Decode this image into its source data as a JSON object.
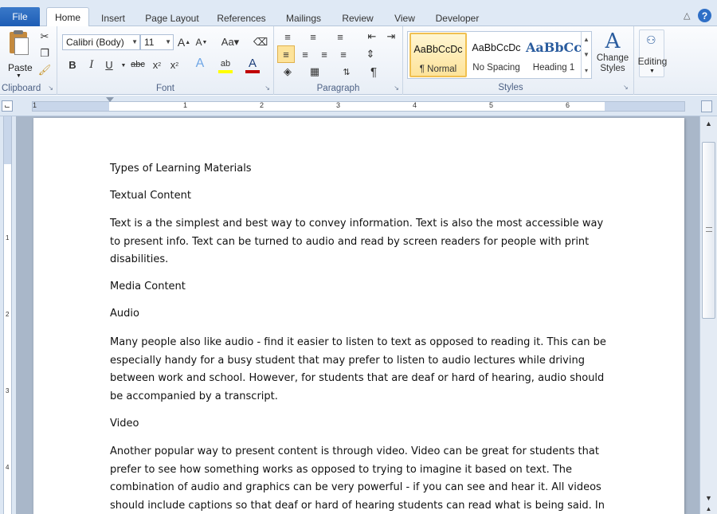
{
  "tabs": {
    "file": "File",
    "items": [
      "Home",
      "Insert",
      "Page Layout",
      "References",
      "Mailings",
      "Review",
      "View",
      "Developer"
    ],
    "active": "Home"
  },
  "ribbon": {
    "clipboard": {
      "label": "Clipboard",
      "paste": "Paste"
    },
    "font": {
      "label": "Font",
      "font_name": "Calibri (Body)",
      "font_size": "11"
    },
    "paragraph": {
      "label": "Paragraph"
    },
    "styles": {
      "label": "Styles",
      "items": [
        {
          "sample": "AaBbCcDc",
          "name": "¶ Normal"
        },
        {
          "sample": "AaBbCcDc",
          "name": "No Spacing"
        },
        {
          "sample": "AaBbCc",
          "name": "Heading 1"
        }
      ],
      "change_styles": "Change Styles"
    },
    "editing": {
      "label": "Editing"
    }
  },
  "ruler": {
    "numbers": [
      "1",
      "1",
      "2",
      "3",
      "4",
      "5",
      "6"
    ]
  },
  "vruler": {
    "numbers": [
      "1",
      "2",
      "3",
      "4"
    ]
  },
  "document": {
    "paragraphs": [
      "Types of Learning Materials",
      "Textual Content",
      "Text is a the simplest and best way to convey information. Text is also the most accessible way to present info. Text can be turned to audio and read by screen readers for people with print disabilities.",
      "Media Content",
      "Audio",
      "Many people also like audio - find it easier to listen to text as opposed to reading it. This can be especially handy for a busy student that may prefer to listen to audio lectures while driving between work and school. However, for students that are deaf or hard of hearing, audio should be accompanied by a transcript.",
      "Video",
      "Another popular way to present content is through video. Video can be great for students that prefer to see how something works as opposed to trying to imagine it based on text. The combination of audio and graphics can be very powerful - if you can see and hear it. All videos should include captions so that deaf or hard of hearing students can read what is being said. In"
    ]
  },
  "colors": {
    "file_tab": "#2a6bc0",
    "accent": "#2f6fc6",
    "highlight": "#ffff00",
    "font_color": "#c00000"
  }
}
